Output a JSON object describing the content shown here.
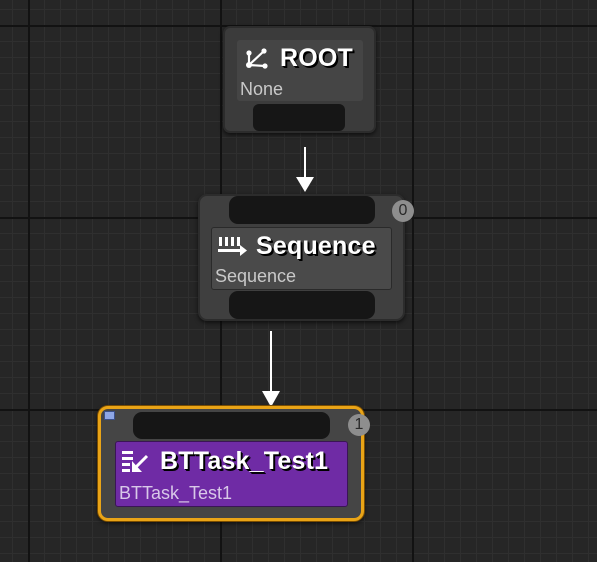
{
  "editor": {
    "grid_color": "#262626",
    "wire_color": "#ffffff"
  },
  "nodes": {
    "root": {
      "icon": "root-branch-icon",
      "title": "ROOT",
      "subtitle": "None"
    },
    "sequence": {
      "icon": "sequence-icon",
      "title": "Sequence",
      "subtitle": "Sequence",
      "order": "0"
    },
    "task": {
      "icon": "task-icon",
      "title": "BTTask_Test1",
      "subtitle": "BTTask_Test1",
      "order": "1",
      "selected": true,
      "accent_color": "#6f2ba5",
      "selection_color": "#e9a417"
    }
  }
}
